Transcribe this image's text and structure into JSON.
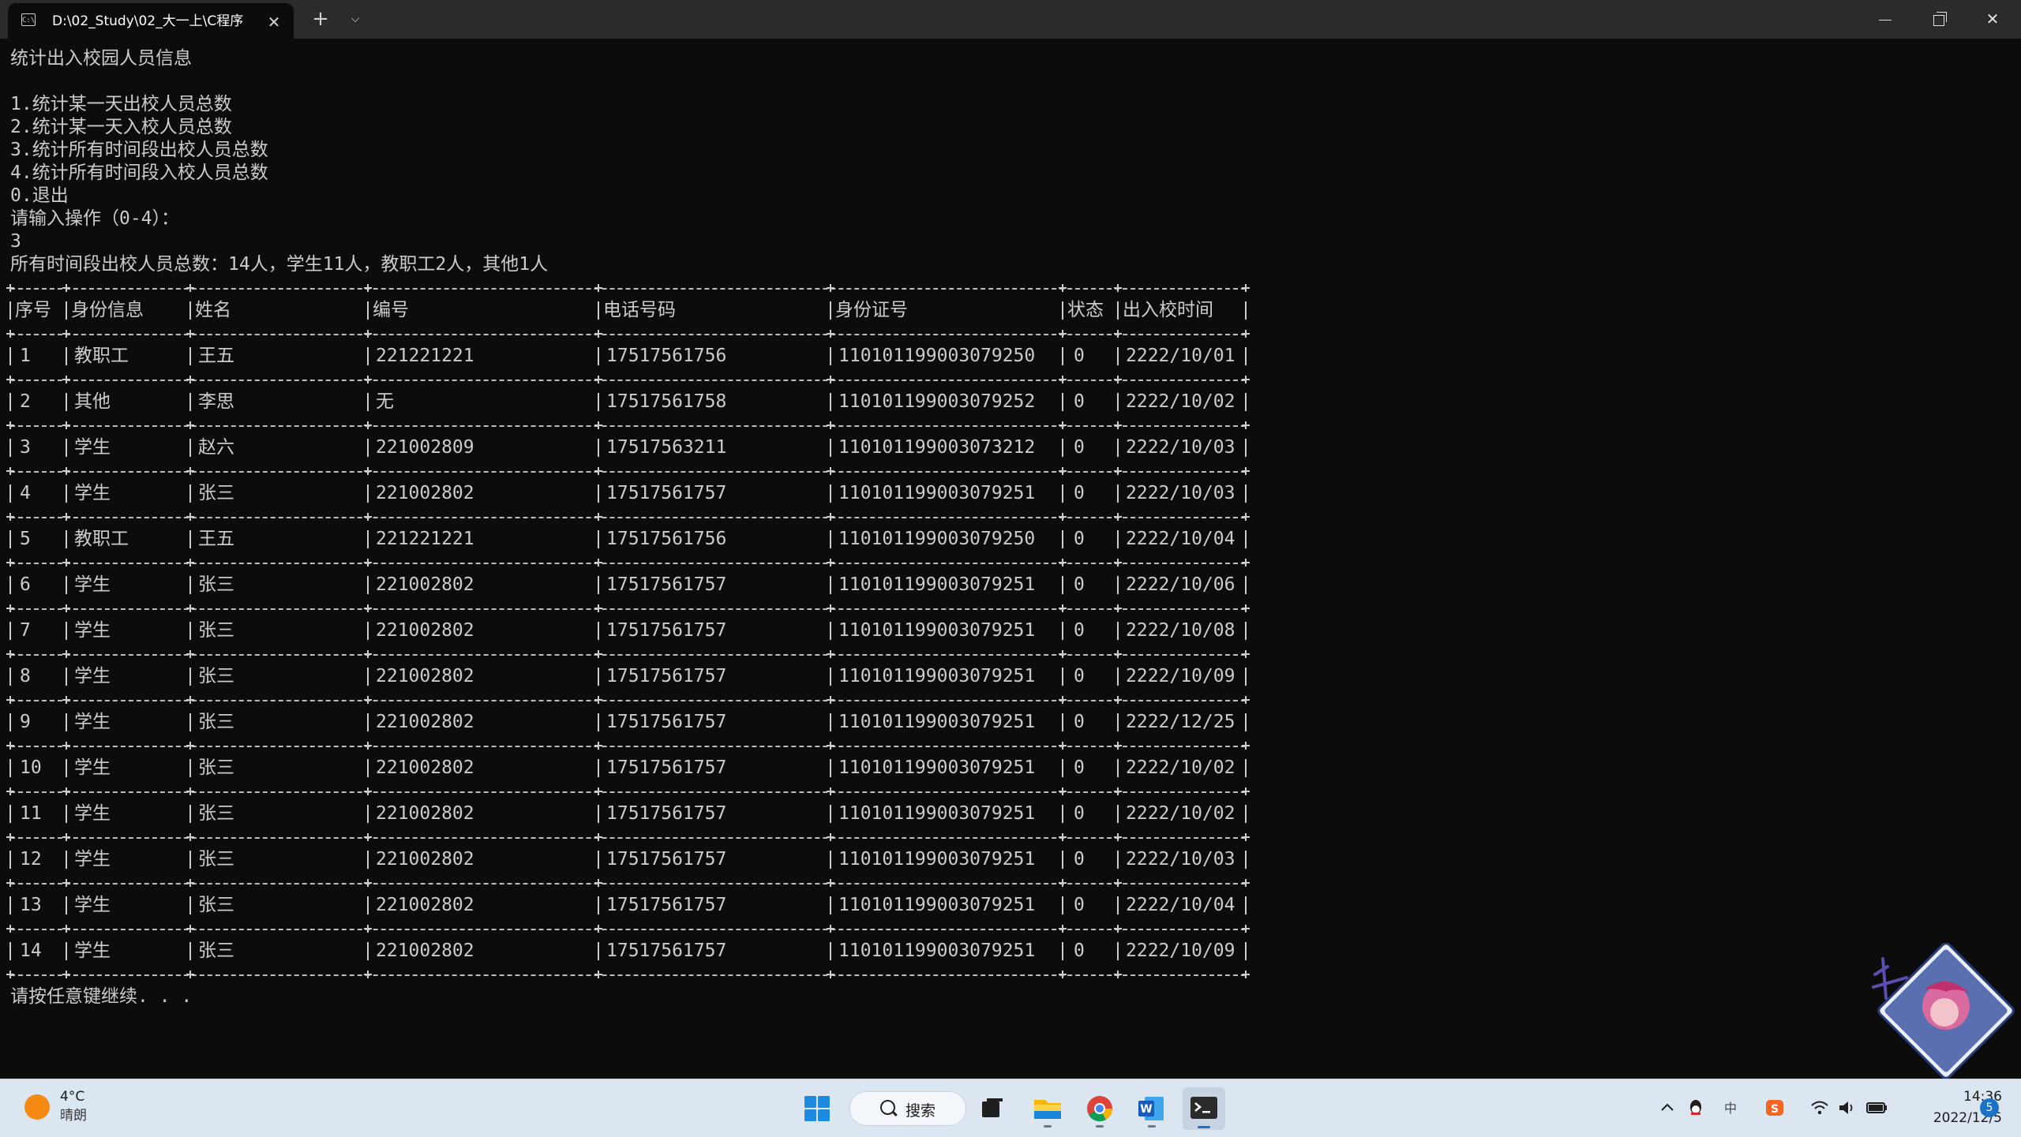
{
  "window": {
    "tab_title": "D:\\02_Study\\02_大一上\\C程序",
    "tab_icon_text": "C:\\"
  },
  "console": {
    "title": "统计出入校园人员信息",
    "menu": [
      "1.统计某一天出校人员总数",
      "2.统计某一天入校人员总数",
      "3.统计所有时间段出校人员总数",
      "4.统计所有时间段入校人员总数",
      "0.退出"
    ],
    "prompt": "请输入操作（0-4）：",
    "user_input": "3",
    "summary": "所有时间段出校人员总数：14人，学生11人，教职工2人，其他1人",
    "headers": [
      "序号",
      "身份信息",
      "姓名",
      "编号",
      "电话号码",
      "身份证号",
      "状态",
      "出入校时间"
    ],
    "rows": [
      {
        "no": "1",
        "identity": "教职工",
        "name": "王五",
        "id": "221221221",
        "phone": "17517561756",
        "idcard": "110101199003079250",
        "status": "0",
        "time": "2222/10/01"
      },
      {
        "no": "2",
        "identity": "其他",
        "name": "李思",
        "id": "无",
        "phone": "17517561758",
        "idcard": "110101199003079252",
        "status": "0",
        "time": "2222/10/02"
      },
      {
        "no": "3",
        "identity": "学生",
        "name": "赵六",
        "id": "221002809",
        "phone": "17517563211",
        "idcard": "110101199003073212",
        "status": "0",
        "time": "2222/10/03"
      },
      {
        "no": "4",
        "identity": "学生",
        "name": "张三",
        "id": "221002802",
        "phone": "17517561757",
        "idcard": "110101199003079251",
        "status": "0",
        "time": "2222/10/03"
      },
      {
        "no": "5",
        "identity": "教职工",
        "name": "王五",
        "id": "221221221",
        "phone": "17517561756",
        "idcard": "110101199003079250",
        "status": "0",
        "time": "2222/10/04"
      },
      {
        "no": "6",
        "identity": "学生",
        "name": "张三",
        "id": "221002802",
        "phone": "17517561757",
        "idcard": "110101199003079251",
        "status": "0",
        "time": "2222/10/06"
      },
      {
        "no": "7",
        "identity": "学生",
        "name": "张三",
        "id": "221002802",
        "phone": "17517561757",
        "idcard": "110101199003079251",
        "status": "0",
        "time": "2222/10/08"
      },
      {
        "no": "8",
        "identity": "学生",
        "name": "张三",
        "id": "221002802",
        "phone": "17517561757",
        "idcard": "110101199003079251",
        "status": "0",
        "time": "2222/10/09"
      },
      {
        "no": "9",
        "identity": "学生",
        "name": "张三",
        "id": "221002802",
        "phone": "17517561757",
        "idcard": "110101199003079251",
        "status": "0",
        "time": "2222/12/25"
      },
      {
        "no": "10",
        "identity": "学生",
        "name": "张三",
        "id": "221002802",
        "phone": "17517561757",
        "idcard": "110101199003079251",
        "status": "0",
        "time": "2222/10/02"
      },
      {
        "no": "11",
        "identity": "学生",
        "name": "张三",
        "id": "221002802",
        "phone": "17517561757",
        "idcard": "110101199003079251",
        "status": "0",
        "time": "2222/10/02"
      },
      {
        "no": "12",
        "identity": "学生",
        "name": "张三",
        "id": "221002802",
        "phone": "17517561757",
        "idcard": "110101199003079251",
        "status": "0",
        "time": "2222/10/03"
      },
      {
        "no": "13",
        "identity": "学生",
        "name": "张三",
        "id": "221002802",
        "phone": "17517561757",
        "idcard": "110101199003079251",
        "status": "0",
        "time": "2222/10/04"
      },
      {
        "no": "14",
        "identity": "学生",
        "name": "张三",
        "id": "221002802",
        "phone": "17517561757",
        "idcard": "110101199003079251",
        "status": "0",
        "time": "2222/10/09"
      }
    ],
    "continue_prompt": "请按任意键继续. . ."
  },
  "taskbar": {
    "weather_temp": "4°C",
    "weather_desc": "晴朗",
    "search_label": "搜索",
    "clock_time": "14:36",
    "clock_date": "2022/12/5",
    "notification_count": "5",
    "apps": [
      "start-icon",
      "task-view-icon",
      "file-explorer-icon",
      "chrome-icon",
      "word-icon",
      "terminal-icon"
    ],
    "tray_icons": [
      "chevron-up-icon",
      "qq-icon",
      "ime-icon",
      "sogou-icon",
      "wifi-icon",
      "volume-icon",
      "battery-icon"
    ]
  },
  "colors": {
    "console_bg": "#0c0c0c",
    "console_text": "#cccccc",
    "titlebar_bg": "#2b2b2b",
    "taskbar_bg": "#dce6f1",
    "accent": "#1a73c6"
  }
}
